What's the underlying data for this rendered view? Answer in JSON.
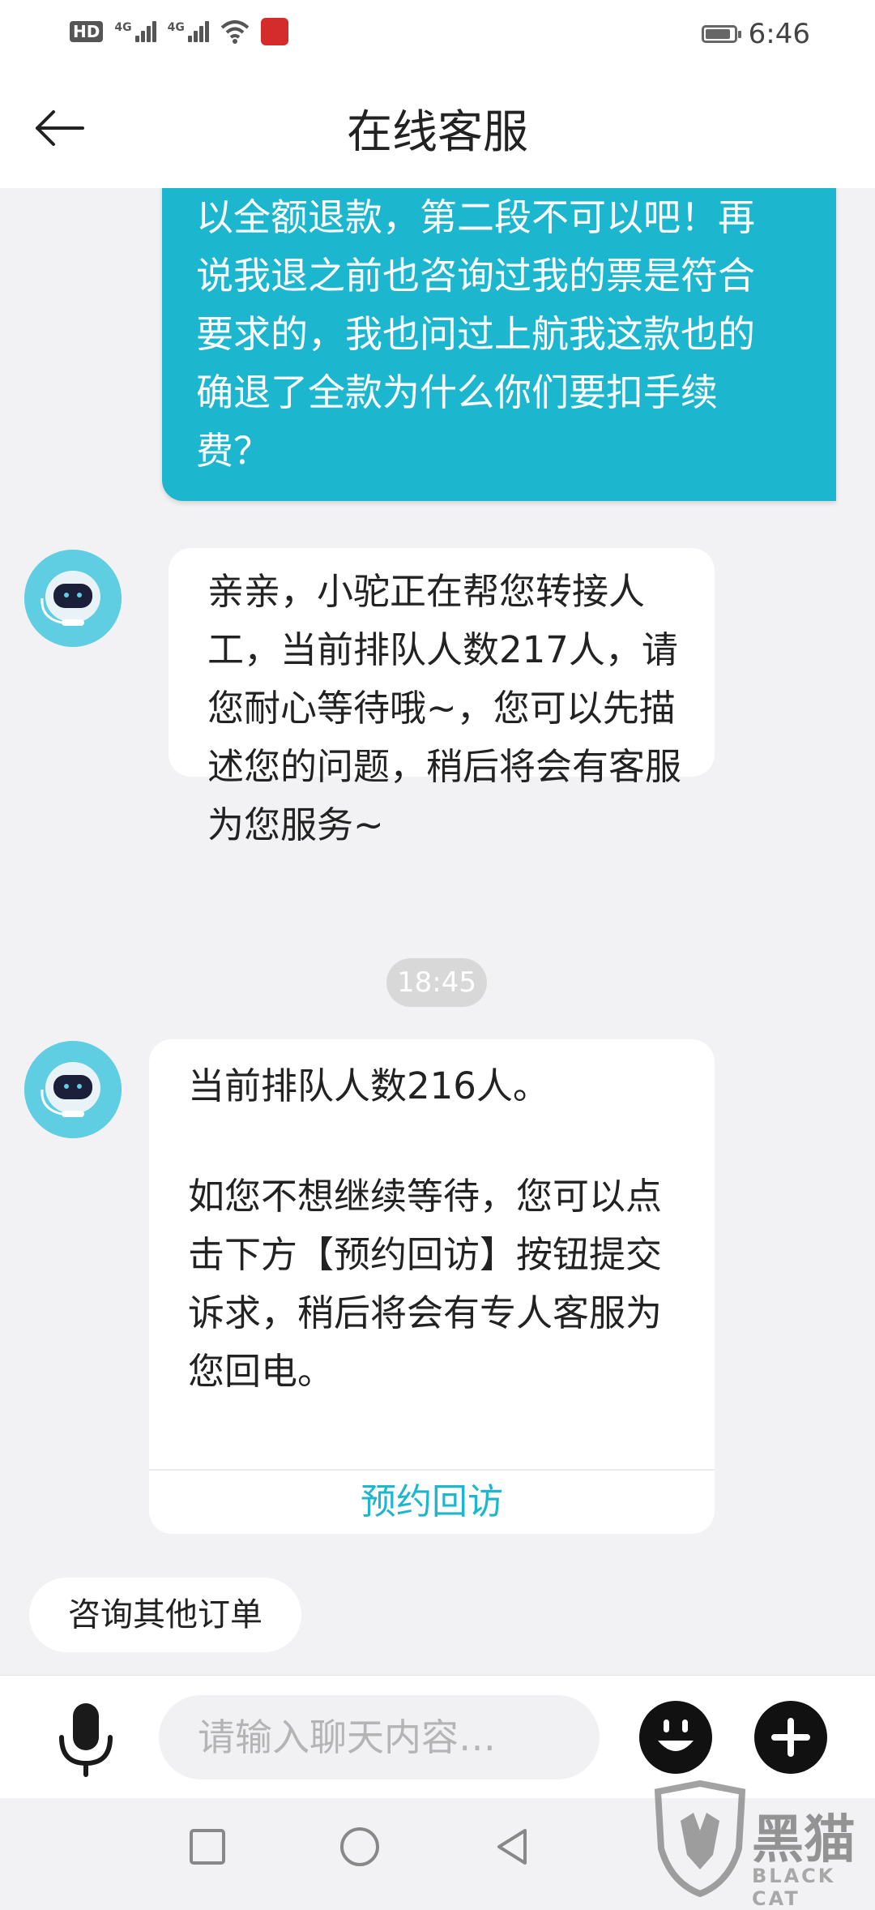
{
  "status_bar": {
    "hd_label": "HD",
    "net1_label": "4G",
    "net2_label": "4G",
    "time": "6:46"
  },
  "header": {
    "title": "在线客服"
  },
  "messages": {
    "outgoing_text": "以全额退款，第二段不可以吧！再说我退之前也咨询过我的票是符合要求的，我也问过上航我这款也的确退了全款为什么你们要扣手续费？",
    "bot_reply_1": "亲亲，小驼正在帮您转接人工，当前排队人数217人，请您耐心等待哦~，您可以先描述您的问题，稍后将会有客服为您服务~",
    "timestamp": "18:45",
    "bot_reply_2_line1": "当前排队人数216人。",
    "bot_reply_2_line2": "如您不想继续等待，您可以点击下方【预约回访】按钮提交诉求，稍后将会有专人客服为您回电。",
    "bot_reply_2_action": "预约回访"
  },
  "quick_reply": {
    "label": "咨询其他订单"
  },
  "input": {
    "placeholder": "请输入聊天内容…"
  },
  "watermark": {
    "text": "黑猫",
    "subtext": "BLACK CAT"
  },
  "colors": {
    "accent": "#1db6cf",
    "background": "#f2f2f4",
    "bubble_in": "#ffffff"
  },
  "icons": [
    "back-arrow-icon",
    "robot-avatar-icon",
    "microphone-icon",
    "emoji-icon",
    "plus-icon",
    "square-icon",
    "circle-icon",
    "triangle-back-icon"
  ]
}
